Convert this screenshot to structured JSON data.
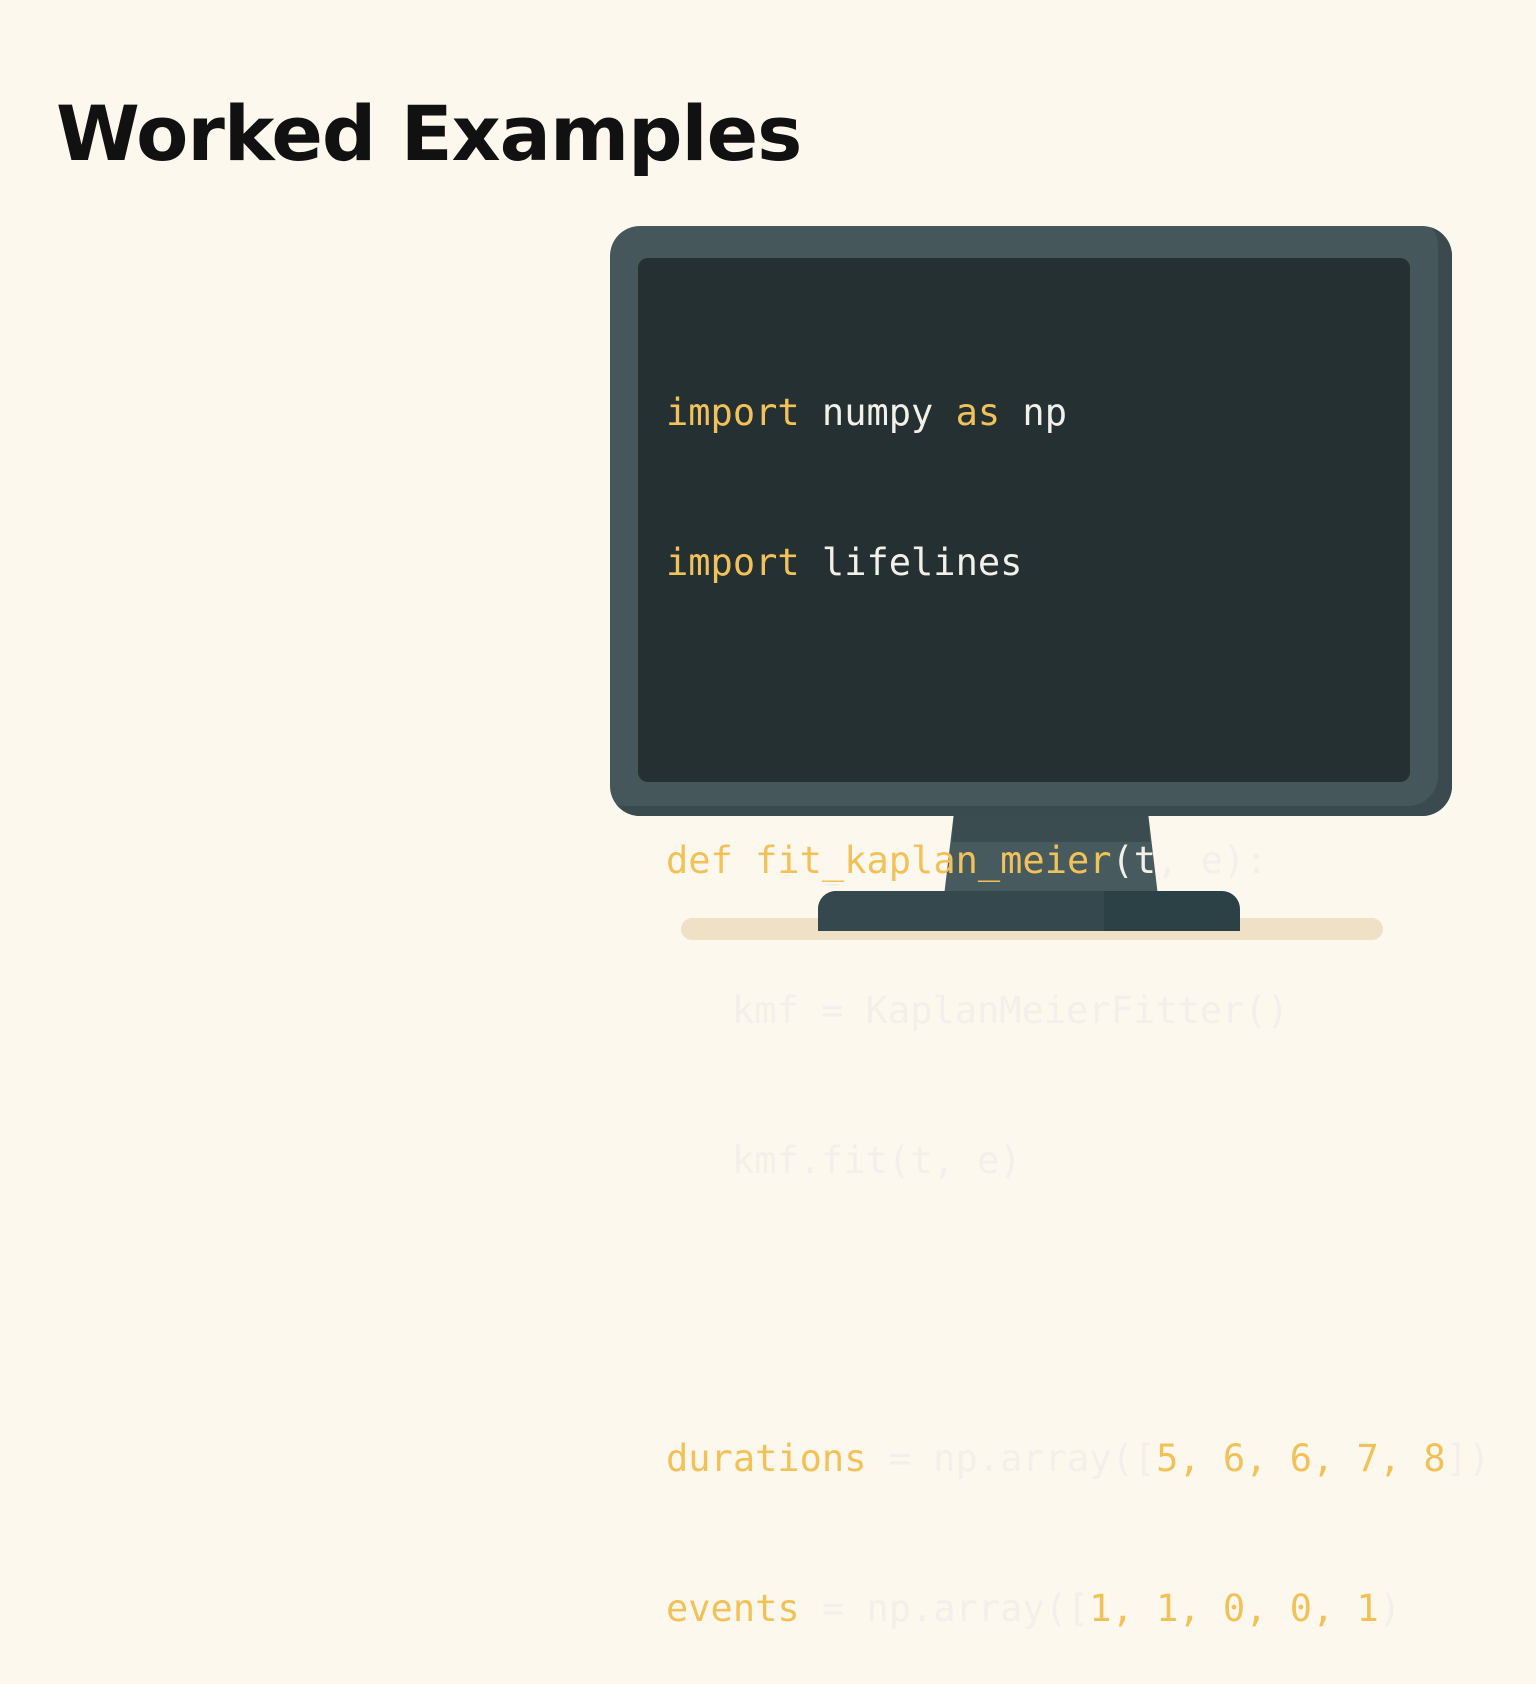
{
  "title": "Worked Examples",
  "colors": {
    "background": "#fdf8ee",
    "monitor": "#45575b",
    "screen": "#243032",
    "keyword": "#f2c25a",
    "text": "#f2f0e8"
  },
  "code": {
    "l1": {
      "kw1": "import",
      "t1": " numpy ",
      "kw2": "as",
      "t2": " np"
    },
    "l2": {
      "kw1": "import",
      "t1": " lifelines"
    },
    "l3": {
      "kw1": "def",
      "sp": " ",
      "kw2": "fit_kaplan_meier",
      "t1": "(t, e):"
    },
    "l4": {
      "t1": "kmf = KaplanMeierFitter()"
    },
    "l5": {
      "t1": "kmf.fit(t, e)"
    },
    "l6": {
      "kw1": "durations",
      "t1": " = np.array([",
      "n1": "5, 6, 6, 7, 8",
      "t2": "])"
    },
    "l7": {
      "kw1": "events",
      "t1": " = np.array([",
      "n1": "1, 1, 0, 0, 1",
      "t2": ")"
    }
  }
}
